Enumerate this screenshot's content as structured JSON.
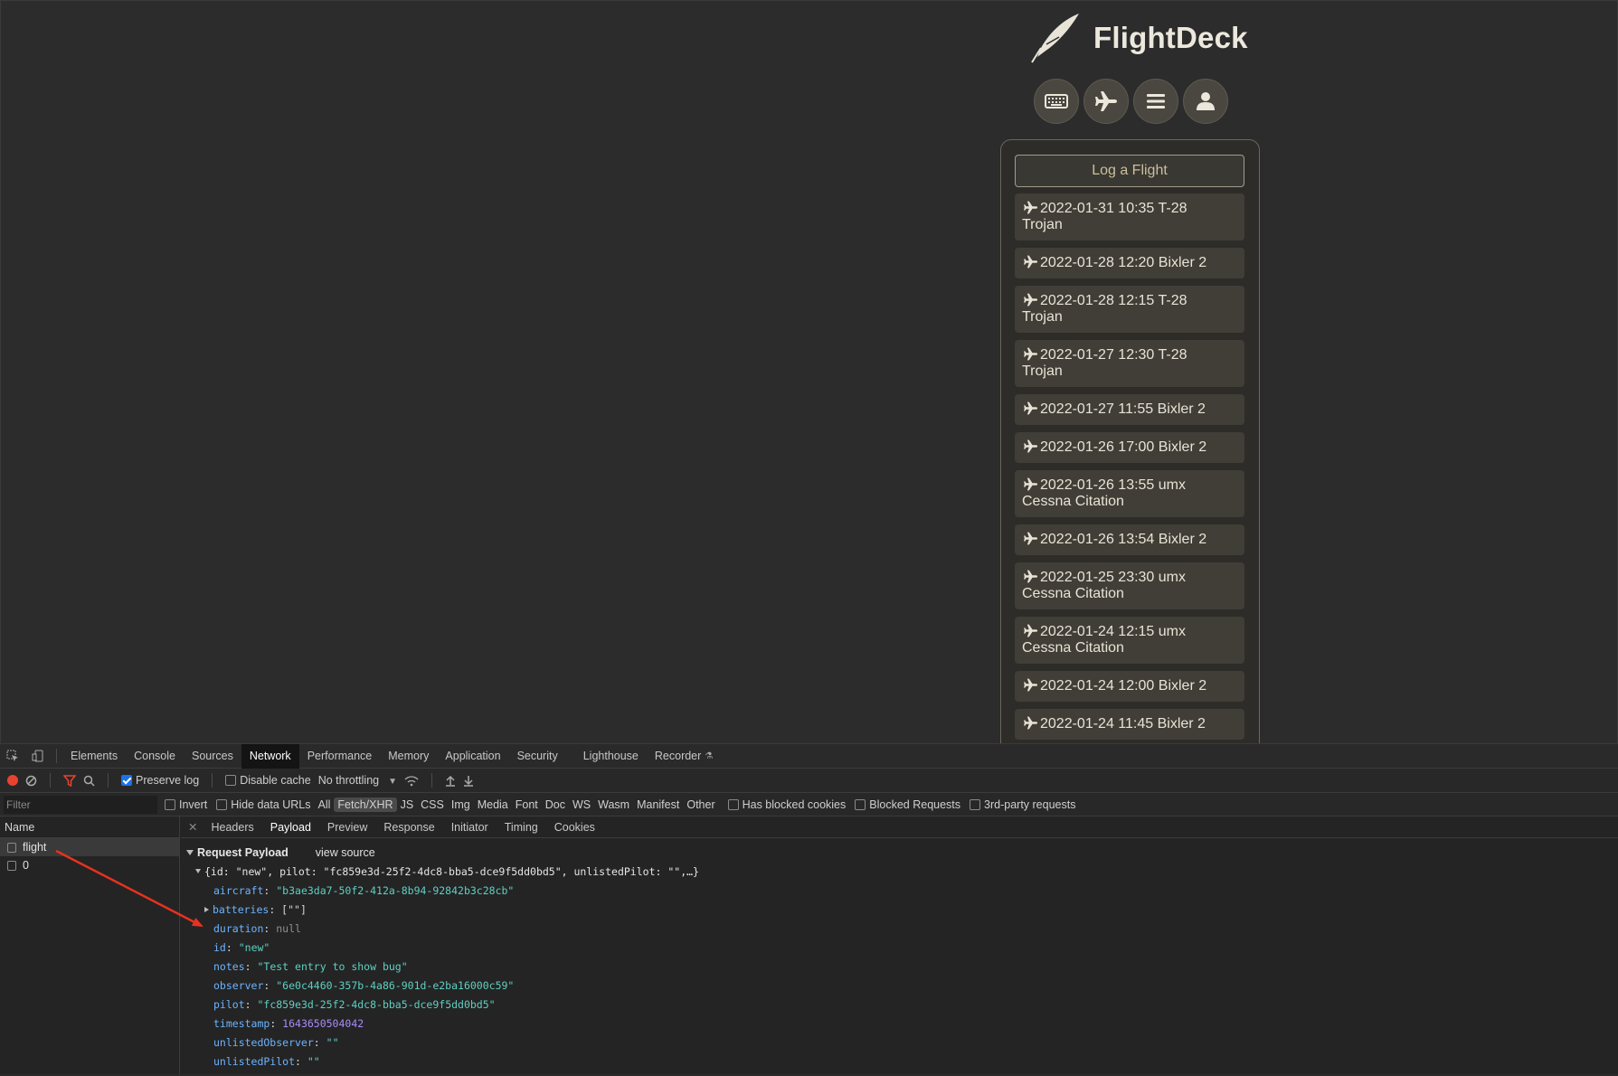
{
  "app": {
    "name": "FlightDeck",
    "log_button": "Log a Flight",
    "nav": [
      {
        "icon": "keyboard-icon"
      },
      {
        "icon": "plane-icon"
      },
      {
        "icon": "menu-icon"
      },
      {
        "icon": "user-icon"
      }
    ],
    "flights": [
      {
        "line1": "2022-01-31 10:35 T-28",
        "line2": "Trojan"
      },
      {
        "line1": "2022-01-28 12:20 Bixler 2",
        "line2": ""
      },
      {
        "line1": "2022-01-28 12:15 T-28",
        "line2": "Trojan"
      },
      {
        "line1": "2022-01-27 12:30 T-28",
        "line2": "Trojan"
      },
      {
        "line1": "2022-01-27 11:55 Bixler 2",
        "line2": ""
      },
      {
        "line1": "2022-01-26 17:00 Bixler 2",
        "line2": ""
      },
      {
        "line1": "2022-01-26 13:55 umx",
        "line2": "Cessna Citation"
      },
      {
        "line1": "2022-01-26 13:54 Bixler 2",
        "line2": ""
      },
      {
        "line1": "2022-01-25 23:30 umx",
        "line2": "Cessna Citation"
      },
      {
        "line1": "2022-01-24 12:15 umx",
        "line2": "Cessna Citation"
      },
      {
        "line1": "2022-01-24 12:00 Bixler 2",
        "line2": ""
      },
      {
        "line1": "2022-01-24 11:45 Bixler 2",
        "line2": ""
      }
    ]
  },
  "devtools": {
    "tabs": [
      "Elements",
      "Console",
      "Sources",
      "Network",
      "Performance",
      "Memory",
      "Application",
      "Security",
      "Lighthouse",
      "Recorder"
    ],
    "active_tab": "Network",
    "toolbar": {
      "preserve_log": "Preserve log",
      "disable_cache": "Disable cache",
      "throttling": "No throttling"
    },
    "filter": {
      "placeholder": "Filter",
      "invert": "Invert",
      "hide_data_urls": "Hide data URLs",
      "types": [
        "All",
        "Fetch/XHR",
        "JS",
        "CSS",
        "Img",
        "Media",
        "Font",
        "Doc",
        "WS",
        "Wasm",
        "Manifest",
        "Other"
      ],
      "active_type": "Fetch/XHR",
      "has_blocked_cookies": "Has blocked cookies",
      "blocked_requests": "Blocked Requests",
      "third_party": "3rd-party requests"
    },
    "name_column": {
      "header": "Name",
      "rows": [
        "flight",
        "0"
      ]
    },
    "detail_tabs": [
      "Headers",
      "Payload",
      "Preview",
      "Response",
      "Initiator",
      "Timing",
      "Cookies"
    ],
    "active_detail_tab": "Payload",
    "payload": {
      "title": "Request Payload",
      "view_source": "view source",
      "summary": "{id: \"new\", pilot: \"fc859e3d-25f2-4dc8-bba5-dce9f5dd0bd5\", unlistedPilot: \"\",…}",
      "fields": [
        {
          "key": "aircraft",
          "value": "\"b3ae3da7-50f2-412a-8b94-92842b3c28cb\"",
          "type": "string"
        },
        {
          "key": "batteries",
          "value": "[\"\"]",
          "type": "array"
        },
        {
          "key": "duration",
          "value": "null",
          "type": "null"
        },
        {
          "key": "id",
          "value": "\"new\"",
          "type": "string"
        },
        {
          "key": "notes",
          "value": "\"Test entry to show bug\"",
          "type": "string"
        },
        {
          "key": "observer",
          "value": "\"6e0c4460-357b-4a86-901d-e2ba16000c59\"",
          "type": "string"
        },
        {
          "key": "pilot",
          "value": "\"fc859e3d-25f2-4dc8-bba5-dce9f5dd0bd5\"",
          "type": "string"
        },
        {
          "key": "timestamp",
          "value": "1643650504042",
          "type": "number"
        },
        {
          "key": "unlistedObserver",
          "value": "\"\"",
          "type": "string"
        },
        {
          "key": "unlistedPilot",
          "value": "\"\"",
          "type": "string"
        }
      ]
    }
  },
  "colors": {
    "annotation_arrow": "#e8321e",
    "devtools_blue": "#1a73e8"
  }
}
